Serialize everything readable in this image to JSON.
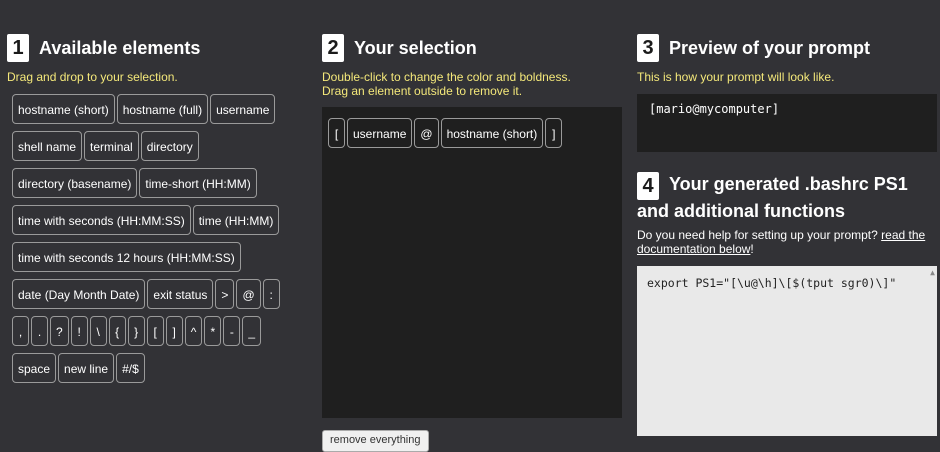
{
  "col1": {
    "number": "1",
    "title": "Available elements",
    "hint": "Drag and drop to your selection.",
    "rows": [
      [
        "hostname (short)",
        "hostname (full)",
        "username"
      ],
      [
        "shell name",
        "terminal",
        "directory"
      ],
      [
        "directory (basename)",
        "time-short (HH:MM)"
      ],
      [
        "time with seconds (HH:MM:SS)",
        "time (HH:MM)"
      ],
      [
        "time with seconds 12 hours (HH:MM:SS)"
      ],
      [
        "date (Day Month Date)",
        "exit status",
        ">",
        "@",
        ":"
      ],
      [
        ",",
        ".",
        "?",
        "!",
        "\\",
        "{",
        "}",
        "[",
        "]",
        "^",
        "*",
        "-",
        "_"
      ],
      [
        "space",
        "new line",
        "#/$"
      ]
    ]
  },
  "col2": {
    "number": "2",
    "title": "Your selection",
    "hint_line1": "Double-click to change the color and boldness.",
    "hint_line2": "Drag an element outside to remove it.",
    "selected": [
      "[",
      "username",
      "@",
      "hostname (short)",
      "]"
    ],
    "remove_button": "remove everything"
  },
  "col3": {
    "number": "3",
    "title": "Preview of your prompt",
    "hint": "This is how your prompt will look like.",
    "preview_text": "[mario@mycomputer]"
  },
  "col4": {
    "number": "4",
    "title_line1": "Your generated .bashrc PS1",
    "title_line2": "and additional functions",
    "help_text": "Do you need help for setting up your prompt? ",
    "help_link": "read the documentation below",
    "help_end": "!",
    "code": "export PS1=\"[\\u@\\h]\\[$(tput sgr0)\\]\""
  }
}
